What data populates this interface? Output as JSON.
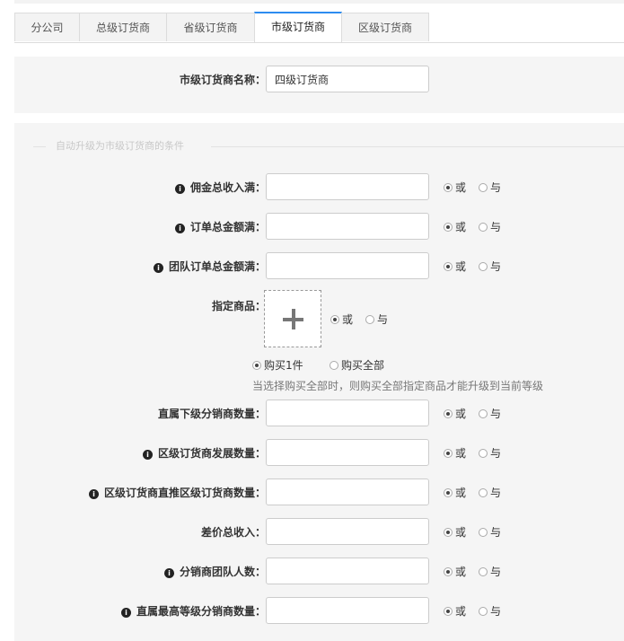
{
  "tabs": [
    "分公司",
    "总级订货商",
    "省级订货商",
    "市级订货商",
    "区级订货商"
  ],
  "name_field": {
    "label": "市级订货商名称：",
    "value": "四级订货商"
  },
  "section_title": "自动升级为市级订货商的条件",
  "conditions": [
    {
      "label": "佣金总收入满：",
      "info": true
    },
    {
      "label": "订单总金额满：",
      "info": true
    },
    {
      "label": "团队订单总金额满：",
      "info": true
    },
    {
      "label": "直属下级分销商数量：",
      "info": false
    },
    {
      "label": "区级订货商发展数量：",
      "info": true
    },
    {
      "label": "区级订货商直推区级订货商数量：",
      "info": true
    },
    {
      "label": "差价总收入：",
      "info": false
    },
    {
      "label": "分销商团队人数：",
      "info": true
    },
    {
      "label": "直属最高等级分销商数量：",
      "info": true
    }
  ],
  "logic": {
    "or": "或",
    "and": "与"
  },
  "product": {
    "label": "指定商品：",
    "buy_one": "购买1件",
    "buy_all": "购买全部",
    "note": "当选择购买全部时，则购买全部指定商品才能升级到当前等级"
  },
  "info_glyph": "i"
}
